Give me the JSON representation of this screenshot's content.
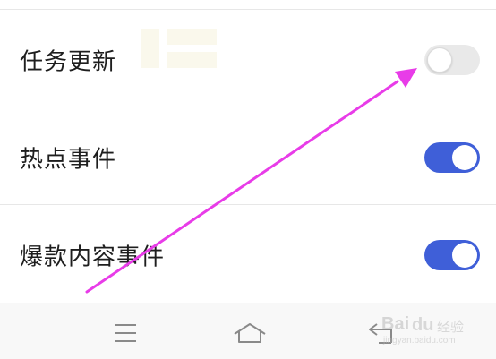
{
  "settings": {
    "items": [
      {
        "label": "任务更新",
        "enabled": false
      },
      {
        "label": "热点事件",
        "enabled": true
      },
      {
        "label": "爆款内容事件",
        "enabled": true
      }
    ]
  },
  "navbar": {
    "buttons": [
      "menu-icon",
      "home-icon",
      "back-icon"
    ]
  },
  "watermark": {
    "brand": "Bai",
    "brand_suffix": "du",
    "sub": "经验",
    "url": "jingyan.baidu.com"
  },
  "colors": {
    "toggle_on": "#3f5fd8",
    "toggle_off": "#e9e9e9",
    "annotation_arrow": "#e83ce8"
  }
}
